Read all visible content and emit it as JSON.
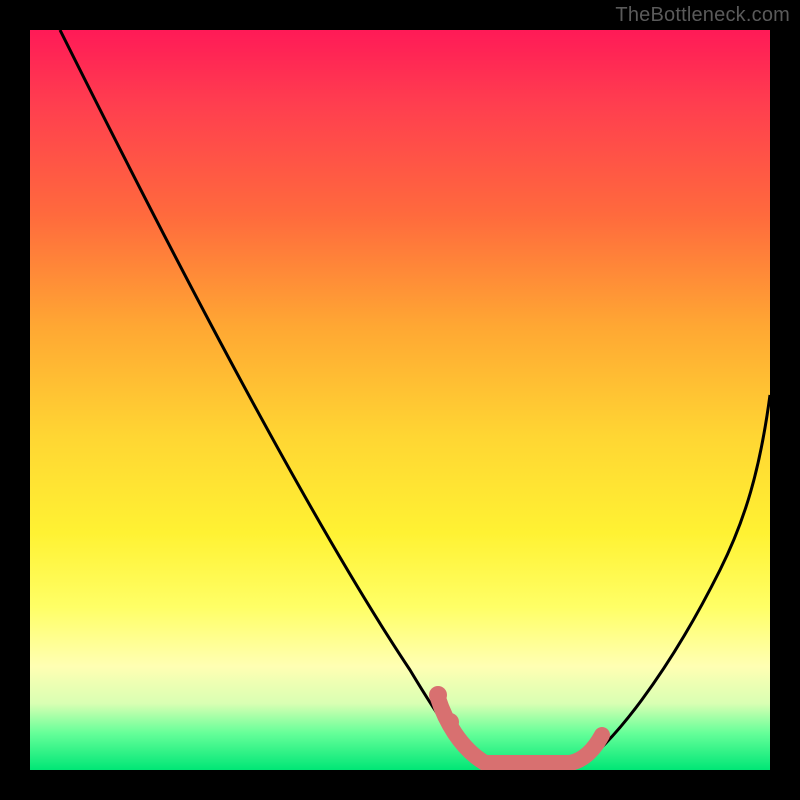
{
  "watermark": "TheBottleneck.com",
  "chart_data": {
    "type": "line",
    "title": "",
    "xlabel": "",
    "ylabel": "",
    "xlim": [
      0,
      100
    ],
    "ylim": [
      0,
      100
    ],
    "note": "Axes unlabeled; values estimated from pixel positions within 740×740 plot. y=0 is bottom (green/optimal), y=100 is top (red/bottleneck).",
    "series": [
      {
        "name": "left-curve",
        "color": "#000000",
        "x": [
          4,
          10,
          20,
          30,
          40,
          50,
          55,
          58,
          60,
          62
        ],
        "y": [
          100,
          89,
          71,
          53,
          35,
          17,
          8,
          3,
          1,
          0
        ]
      },
      {
        "name": "right-curve",
        "color": "#000000",
        "x": [
          74,
          78,
          82,
          86,
          90,
          94,
          98,
          100
        ],
        "y": [
          0,
          3,
          8,
          15,
          24,
          34,
          45,
          51
        ]
      },
      {
        "name": "highlight-band",
        "color": "#e06666",
        "x": [
          55,
          57,
          59,
          62,
          66,
          70,
          73,
          75,
          77
        ],
        "y": [
          10,
          6,
          2,
          0,
          0,
          0,
          0,
          1,
          4
        ]
      }
    ]
  }
}
